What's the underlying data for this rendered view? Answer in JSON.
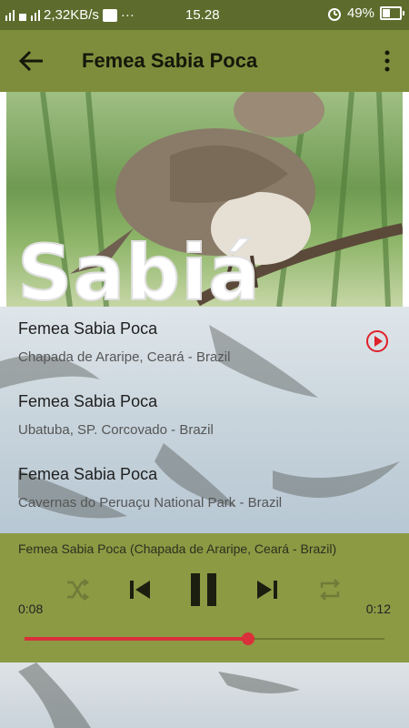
{
  "statusbar": {
    "speed": "2,32KB/s",
    "dots": "···",
    "time": "15.28",
    "battery": "49%"
  },
  "toolbar": {
    "title": "Femea Sabia Poca"
  },
  "hero": {
    "text": "Sabiá Poca"
  },
  "tracks": [
    {
      "title": "Femea Sabia Poca",
      "subtitle": "Chapada de Araripe, Ceará - Brazil"
    },
    {
      "title": "Femea Sabia Poca",
      "subtitle": "Ubatuba, SP. Corcovado - Brazil"
    },
    {
      "title": "Femea Sabia Poca",
      "subtitle": "Cavernas do Peruaçu National Park - Brazil"
    }
  ],
  "player": {
    "now_playing": "Femea Sabia Poca (Chapada de Araripe, Ceará - Brazil)",
    "elapsed": "0:08",
    "total": "0:12",
    "progress": 0.62
  },
  "colors": {
    "accent": "#d9303a",
    "toolbar": "#7e8d3c",
    "player": "#8c9a44"
  }
}
